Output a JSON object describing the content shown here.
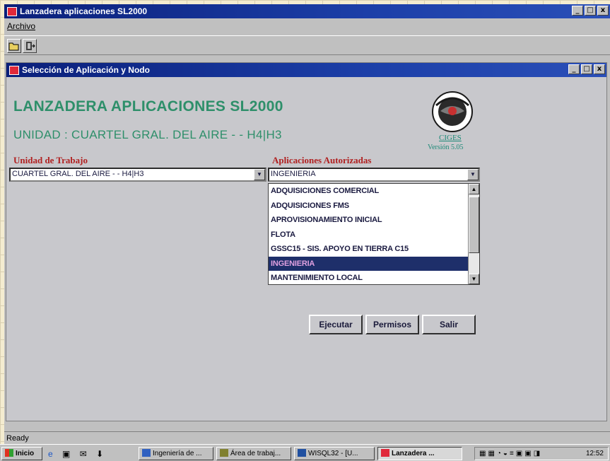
{
  "window": {
    "title": "Lanzadera aplicaciones SL2000",
    "controls": [
      "_",
      "□",
      "x"
    ]
  },
  "menu": {
    "archivo": "Archivo"
  },
  "dialog": {
    "title": "Selección de Aplicación y Nodo",
    "heading": "LANZADERA APLICACIONES SL2000",
    "unidad_line": "UNIDAD :  CUARTEL GRAL. DEL AIRE -  - H4|H3",
    "logo_label": "CIGES",
    "version": "Versión 5.05",
    "unidad_trabajo_label": "Unidad de Trabajo",
    "unidad_trabajo_value": "CUARTEL GRAL. DEL AIRE - - H4|H3",
    "aplicaciones_label": "Aplicaciones Autorizadas",
    "aplicaciones_value": "INGENIERIA",
    "aplicaciones_options": [
      "ADQUISICIONES COMERCIAL",
      "ADQUISICIONES FMS",
      "APROVISIONAMIENTO INICIAL",
      "FLOTA",
      "GSSC15 - SIS. APOYO EN TIERRA C15",
      "INGENIERIA",
      "MANTENIMIENTO LOCAL"
    ],
    "selected_index": 5,
    "buttons": {
      "ejecutar": "Ejecutar",
      "permisos": "Permisos",
      "salir": "Salir"
    }
  },
  "status": "Ready",
  "taskbar": {
    "start": "Inicio",
    "items": [
      "Ingeniería de ...",
      "Área de trabaj...",
      "WISQL32 - [U...",
      "Lanzadera ..."
    ],
    "clock": "12:52"
  },
  "colors": {
    "title_bar": "#1c3fa8",
    "heading": "#2e8f6a",
    "label": "#b02020",
    "selection": "#1e2f6a"
  }
}
